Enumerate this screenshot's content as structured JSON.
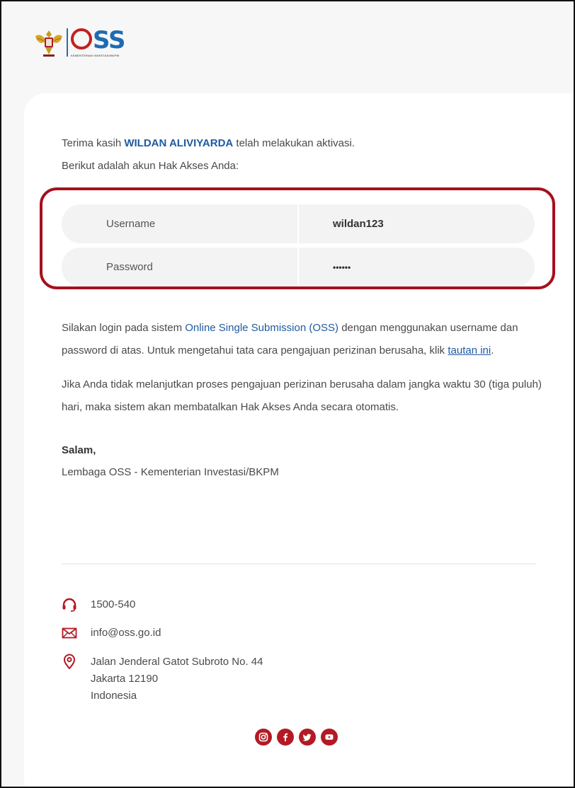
{
  "header": {
    "logo_text": "SS",
    "logo_subtitle": "KEMENTERIAN INVESTASI/BKPM"
  },
  "email": {
    "greeting_prefix": "Terima kasih ",
    "user_name": "WILDAN ALIVIYARDA",
    "greeting_suffix": " telah melakukan aktivasi.",
    "intro_line": "Berikut adalah akun Hak Akses Anda:",
    "credentials": {
      "username_label": "Username",
      "username_value": "wildan123",
      "password_label": "Password",
      "password_value": "••••••"
    },
    "para1_part1": "Silakan login pada sistem ",
    "para1_link": "Online Single Submission (OSS)",
    "para1_part2": " dengan menggunakan username dan password di atas. Untuk mengetahui tata cara pengajuan perizinan berusaha, klik ",
    "para1_link2": "tautan ini",
    "para1_end": ".",
    "para2": "Jika Anda tidak melanjutkan proses pengajuan perizinan berusaha dalam jangka waktu 30 (tiga puluh) hari, maka sistem akan membatalkan Hak Akses Anda secara otomatis.",
    "sign_bold": "Salam,",
    "sign_org": "Lembaga OSS - Kementerian Investasi/BKPM"
  },
  "contact": {
    "phone": "1500-540",
    "email": "info@oss.go.id",
    "address_line1": "Jalan Jenderal Gatot Subroto No. 44",
    "address_line2": "Jakarta 12190",
    "address_line3": "Indonesia"
  },
  "icons": {
    "phone": "headset-icon",
    "mail": "envelope-icon",
    "location": "map-pin-icon",
    "social": [
      "instagram-icon",
      "facebook-icon",
      "twitter-icon",
      "youtube-icon"
    ]
  },
  "colors": {
    "brand_blue": "#1f6bb3",
    "brand_red": "#b31a24",
    "highlight_border": "#a5101d"
  }
}
